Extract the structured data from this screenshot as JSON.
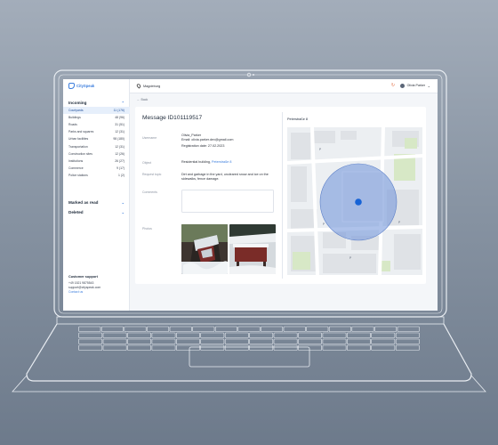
{
  "app": {
    "logo_text": "CitySpeak"
  },
  "topbar": {
    "location": "Magdeburg",
    "user_name": "Olivia Parker"
  },
  "nav": {
    "back_label": "Back"
  },
  "sidebar": {
    "incoming_label": "Incoming",
    "categories": [
      {
        "label": "Courtyards",
        "count": "11 (176)"
      },
      {
        "label": "Buildings",
        "count": "48 (96)"
      },
      {
        "label": "Roads",
        "count": "31 (51)"
      },
      {
        "label": "Parks and squares",
        "count": "12 (31)"
      },
      {
        "label": "Urban facilities",
        "count": "98 (180)"
      },
      {
        "label": "Transportation",
        "count": "12 (31)"
      },
      {
        "label": "Construction sites",
        "count": "12 (26)"
      },
      {
        "label": "Institutions",
        "count": "26 (27)"
      },
      {
        "label": "Commerce",
        "count": "9 (17)"
      },
      {
        "label": "Police stations",
        "count": "1 (2)"
      }
    ],
    "marked_label": "Marked as read",
    "deleted_label": "Deleted",
    "support": {
      "title": "Customer support",
      "phone": "+49 1521 9875543",
      "email": "support@cityspeak.com",
      "contact_link": "Contact us"
    }
  },
  "message": {
    "title": "Message ID101119517",
    "username_label": "Username",
    "username_name": "Olivia_Parker",
    "username_email": "Email: olivia.parker.dev@gmail.com",
    "registration": "Registration date: 27.02.2023",
    "object_label": "Object",
    "object_value": "Residential building,",
    "object_link": "Peterstraße 8",
    "request_label": "Request topic",
    "request_value": "Dirt and garbage in the yard, uncleared snow and ice on the sidewalks, fence damage.",
    "comments_label": "Comments",
    "photos_label": "Photos",
    "photos": [
      "photo-icy-gate",
      "photo-snow-bench"
    ]
  },
  "map": {
    "address": "Peterstraße 8"
  },
  "colors": {
    "accent": "#3b7ddd",
    "active_bg": "#e6effb",
    "marker": "#1763d6",
    "radius_fill": "#6c8fd8"
  }
}
